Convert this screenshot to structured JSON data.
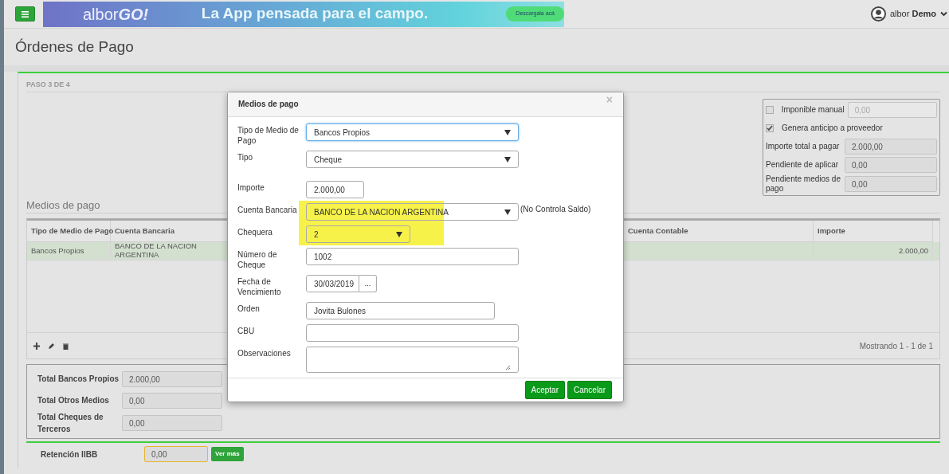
{
  "header": {
    "banner": {
      "brand": "albor",
      "brand_bold": "GO!",
      "tagline": "La App pensada para el campo.",
      "button": "Descargala acá"
    },
    "user": {
      "name": "albor",
      "bold": "Demo"
    }
  },
  "page_title": "Órdenes de Pago",
  "step": "PASO 3 DE 4",
  "summary": [
    {
      "kind": "checkbox",
      "label": "Imponible manual",
      "checked": false,
      "value": "0,00",
      "disabled": true
    },
    {
      "kind": "checkbox",
      "label": "Genera anticipo a proveedor",
      "checked": true
    },
    {
      "kind": "field",
      "label": "Importe total a pagar",
      "value": "2.000,00"
    },
    {
      "kind": "field",
      "label": "Pendiente de aplicar",
      "value": "0,00"
    },
    {
      "kind": "field",
      "label": "Pendiente medios de pago",
      "value": "0,00"
    }
  ],
  "payments": {
    "title": "Medios de pago",
    "columns": [
      "Tipo de Medio de Pago",
      "Cuenta Bancaria",
      "Cuenta Contable",
      "Importe"
    ],
    "rows": [
      {
        "tipo": "Bancos Propios",
        "cuenta": "BANCO DE LA NACION ARGENTINA",
        "importe": "2.000,00",
        "selected": true
      }
    ],
    "footer": "Mostrando 1 - 1 de 1"
  },
  "totals": [
    {
      "label": "Total Bancos Propios",
      "value": "2.000,00"
    },
    {
      "label": "Total Otros Medios",
      "value": "0,00"
    },
    {
      "label": "Total Cheques de Terceros",
      "value": "0,00"
    }
  ],
  "retenciones": [
    {
      "label": "Retención IIBB",
      "value": "0,00",
      "button": "Ver más"
    }
  ],
  "modal": {
    "title": "Medios de pago",
    "close": "×",
    "fields": [
      {
        "kind": "select",
        "label": "Tipo de Medio de Pago",
        "value": "Bancos Propios",
        "focused": true
      },
      {
        "kind": "select",
        "label": "Tipo",
        "value": "Cheque"
      },
      {
        "kind": "amount",
        "label": "Importe",
        "value": "2.000,00"
      },
      {
        "kind": "select",
        "label": "Cuenta Bancaria",
        "value": "BANCO DE LA NACION ARGENTINA",
        "note": "(No Controla Saldo)",
        "highlighted": true
      },
      {
        "kind": "short-select",
        "label": "Chequera",
        "value": "2",
        "highlighted": true
      },
      {
        "kind": "text",
        "label": "Número de Cheque",
        "value": "1002"
      },
      {
        "kind": "date",
        "label": "Fecha de Vencimiento",
        "value": "30/03/2019",
        "button": "..."
      },
      {
        "kind": "medium-text",
        "label": "Orden",
        "value": "Jovita Bulones"
      },
      {
        "kind": "text",
        "label": "CBU"
      },
      {
        "kind": "textarea",
        "label": "Observaciones"
      }
    ],
    "buttons": [
      "Aceptar",
      "Cancelar"
    ]
  }
}
